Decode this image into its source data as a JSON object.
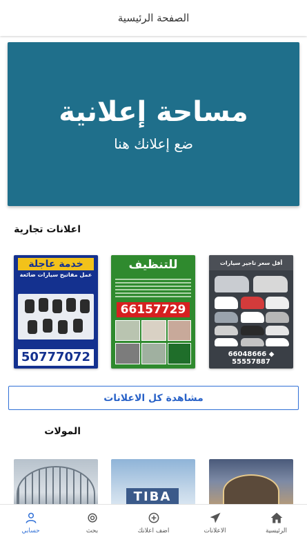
{
  "header": {
    "title": "الصفحة الرئيسية"
  },
  "banner": {
    "title": "مساحة إعلانية",
    "subtitle": "ضع إعلانك هنا"
  },
  "sections": {
    "ads_title": "اعلانات تجارية",
    "malls_title": "المولات"
  },
  "ads": [
    {
      "headline": "أقل سعر تاجير سيارات",
      "phones": "66048666 ◆ 55557887"
    },
    {
      "headline": "للتنظيف",
      "phone": "66157729"
    },
    {
      "headline": "خدمة عاجلة",
      "subline": "عمل مفاتيح سيارات ضائعة",
      "phone": "50777072"
    }
  ],
  "view_all": {
    "label": "مشاهدة كل الاعلانات"
  },
  "malls": [
    {
      "sign": "TIBA"
    }
  ],
  "tabbar": {
    "home": "الرئيسية",
    "ads": "الاعلانات",
    "add_ad": "اضف اعلانك",
    "search": "بحث",
    "account": "حسابي"
  },
  "colors": {
    "accent": "#2f6fd6",
    "banner": "#1f6f8b"
  },
  "icons": {
    "home": "home-icon",
    "ads": "send-icon",
    "add": "plus-circle-icon",
    "search": "search-icon",
    "account": "user-icon"
  }
}
